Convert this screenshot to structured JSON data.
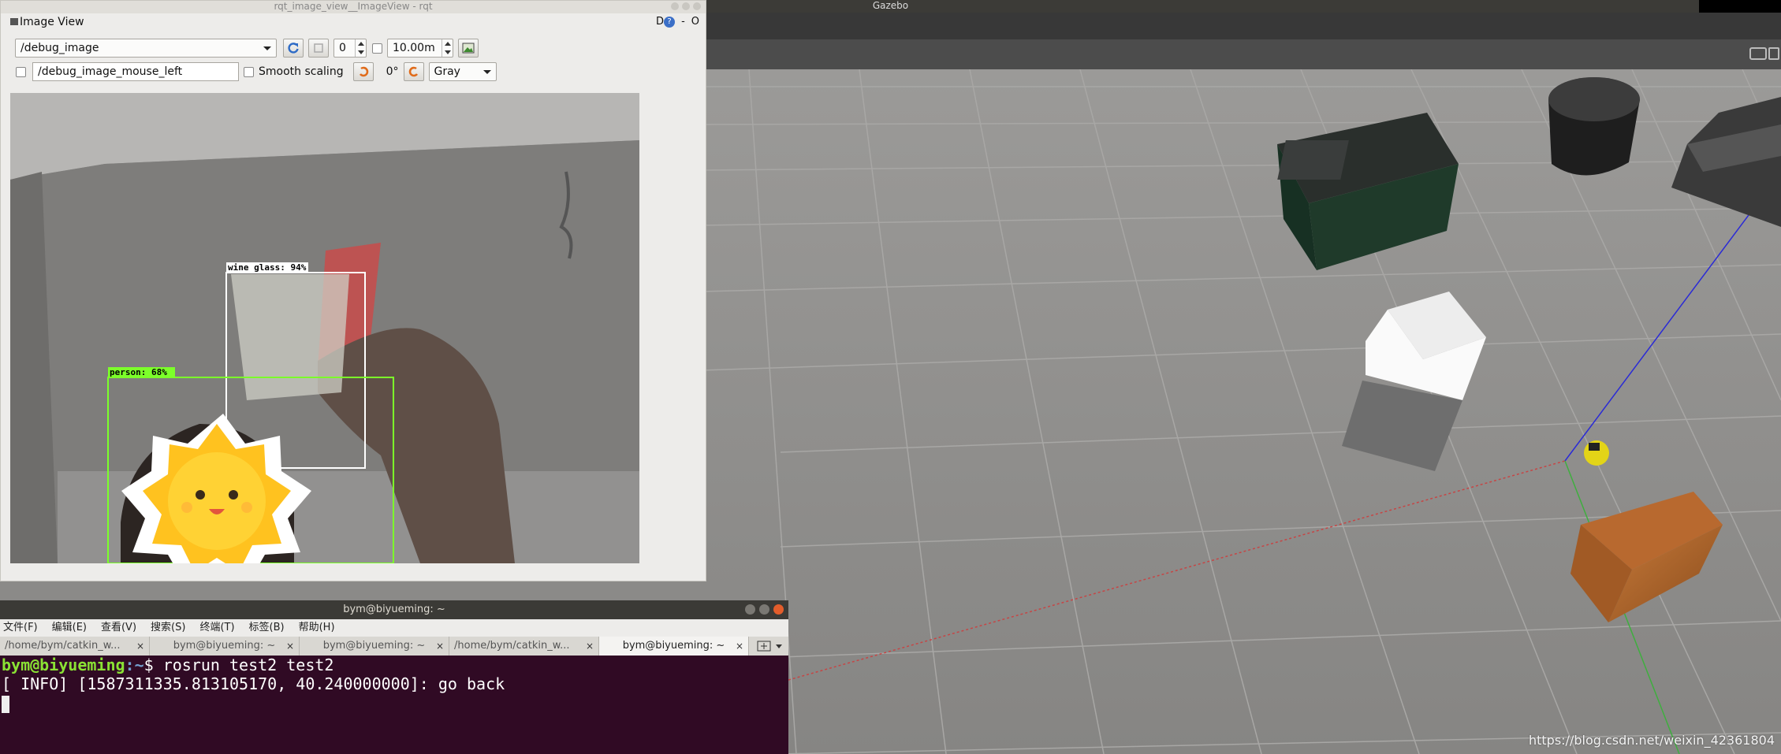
{
  "gazebo": {
    "title": "Gazebo"
  },
  "rqt": {
    "window_title": "rqt_image_view__ImageView - rqt",
    "plugin_title": "Image View",
    "dock_d": "D",
    "dock_help": "?",
    "dock_dash": "-",
    "dock_o": "O",
    "topic": "/debug_image",
    "spin_value": "0",
    "distance_value": "10.00m",
    "mouse_topic": "/debug_image_mouse_left",
    "smooth_scaling_label": "Smooth scaling",
    "rotation_label": "0°",
    "color_scheme": "Gray",
    "detections": [
      {
        "label": "wine glass: 94%"
      },
      {
        "label": "person: 68%"
      }
    ]
  },
  "terminal": {
    "title": "bym@biyueming: ~",
    "menu": [
      "文件(F)",
      "编辑(E)",
      "查看(V)",
      "搜索(S)",
      "终端(T)",
      "标签(B)",
      "帮助(H)"
    ],
    "tabs": [
      {
        "label": "/home/bym/catkin_w...",
        "active": false
      },
      {
        "label": "bym@biyueming: ~",
        "active": false
      },
      {
        "label": "bym@biyueming: ~",
        "active": false
      },
      {
        "label": "/home/bym/catkin_w...",
        "active": false
      },
      {
        "label": "bym@biyueming: ~",
        "active": true
      }
    ],
    "prompt_user": "bym@biyueming",
    "prompt_path": ":~",
    "command": "$ rosrun test2 test2",
    "output": "[ INFO] [1587311335.813105170, 40.240000000]: go back"
  },
  "watermark": "https://blog.csdn.net/weixin_42361804",
  "colors": {
    "terminal_bg": "#300a24",
    "gazebo_ground": "#8f8e8c",
    "detection_person": "#7cff2a",
    "detection_glass": "#ffffff"
  }
}
